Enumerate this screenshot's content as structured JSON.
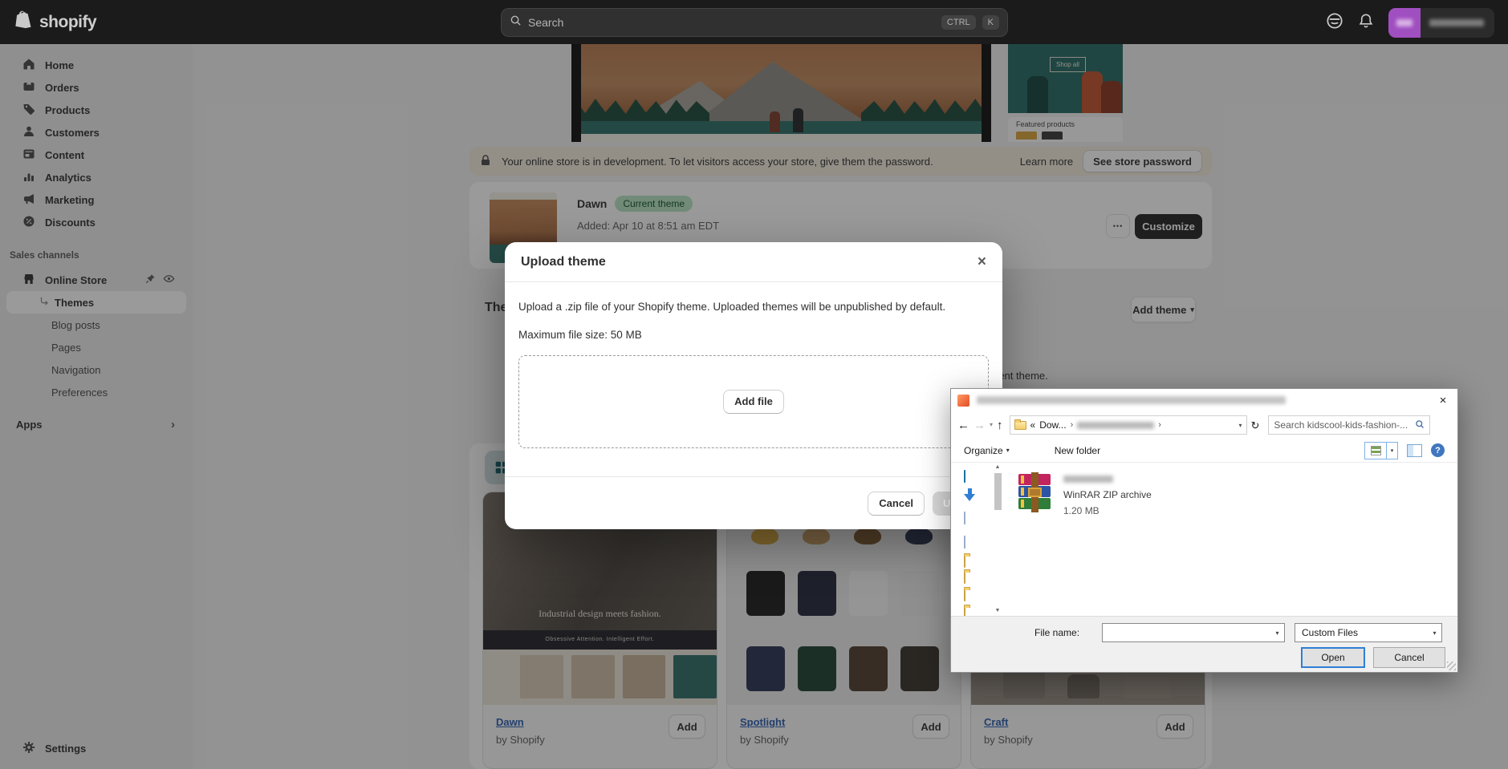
{
  "topbar": {
    "logo": "shopify",
    "search_placeholder": "Search",
    "shortcut_ctrl": "CTRL",
    "shortcut_k": "K"
  },
  "sidebar": {
    "items": [
      {
        "label": "Home"
      },
      {
        "label": "Orders"
      },
      {
        "label": "Products"
      },
      {
        "label": "Customers"
      },
      {
        "label": "Content"
      },
      {
        "label": "Analytics"
      },
      {
        "label": "Marketing"
      },
      {
        "label": "Discounts"
      }
    ],
    "sales_channels_label": "Sales channels",
    "online_store_label": "Online Store",
    "sub_items": [
      {
        "label": "Themes"
      },
      {
        "label": "Blog posts"
      },
      {
        "label": "Pages"
      },
      {
        "label": "Navigation"
      },
      {
        "label": "Preferences"
      }
    ],
    "apps_label": "Apps",
    "settings_label": "Settings"
  },
  "preview": {
    "shop_all": "Shop all",
    "featured_products": "Featured products"
  },
  "banner": {
    "message": "Your online store is in development. To let visitors access your store, give them the password.",
    "learn_more": "Learn more",
    "cta": "See store password"
  },
  "current_theme": {
    "name": "Dawn",
    "badge": "Current theme",
    "added": "Added: Apr 10 at 8:51 am EDT",
    "customize": "Customize"
  },
  "library": {
    "heading_fragment": "The",
    "add_theme": "Add theme",
    "text_fragment": "rent theme."
  },
  "popular": {
    "cards": [
      {
        "name": "Dawn",
        "by": "by Shopify",
        "add": "Add",
        "caption": "Industrial design meets fashion.",
        "subcaption": "Obsessive Attention. Intelligent Effort."
      },
      {
        "name": "Spotlight",
        "by": "by Shopify",
        "add": "Add"
      },
      {
        "name": "Craft",
        "by": "by Shopify",
        "add": "Add"
      }
    ]
  },
  "upload_modal": {
    "title": "Upload theme",
    "description": "Upload a .zip file of your Shopify theme. Uploaded themes will be unpublished by default.",
    "max_size": "Maximum file size: 50 MB",
    "add_file": "Add file",
    "cancel": "Cancel",
    "upload": "Upload"
  },
  "file_dialog": {
    "breadcrumb_prefix": "«",
    "breadcrumb_root": "Dow...",
    "search_placeholder": "Search kidscool-kids-fashion-...",
    "organize": "Organize",
    "new_folder": "New folder",
    "file_type": "WinRAR ZIP archive",
    "file_size": "1.20 MB",
    "file_name_label": "File name:",
    "filter_value": "Custom Files",
    "open": "Open",
    "cancel": "Cancel"
  },
  "colors": {
    "accent_blue": "#2f7fd4",
    "success_green_bg": "#b6e4c3",
    "topbar": "#1b1b1b",
    "teal_preview": "#256a62"
  },
  "icons": {
    "more": "•••",
    "caret": "▾",
    "chevron": "›",
    "back": "←",
    "forward": "→",
    "up": "↑",
    "refresh": "↻",
    "guillemet": "«",
    "close": "×",
    "scroll_up": "▲",
    "scroll_down": "▼",
    "help": "?"
  }
}
